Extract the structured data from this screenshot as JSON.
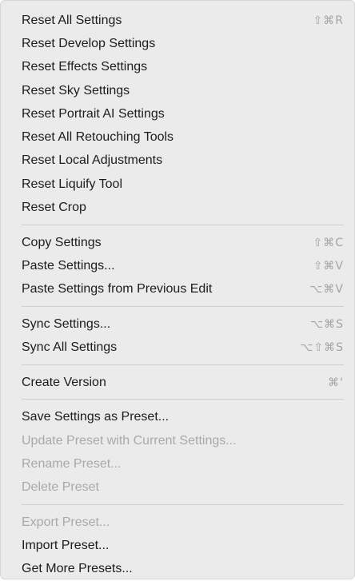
{
  "menu": {
    "groups": [
      [
        {
          "label": "Reset All Settings",
          "shortcut": "⇧⌘R",
          "enabled": true
        },
        {
          "label": "Reset Develop Settings",
          "shortcut": "",
          "enabled": true
        },
        {
          "label": "Reset Effects Settings",
          "shortcut": "",
          "enabled": true
        },
        {
          "label": "Reset Sky Settings",
          "shortcut": "",
          "enabled": true
        },
        {
          "label": "Reset Portrait AI Settings",
          "shortcut": "",
          "enabled": true
        },
        {
          "label": "Reset All Retouching Tools",
          "shortcut": "",
          "enabled": true
        },
        {
          "label": "Reset Local Adjustments",
          "shortcut": "",
          "enabled": true
        },
        {
          "label": "Reset Liquify Tool",
          "shortcut": "",
          "enabled": true
        },
        {
          "label": "Reset Crop",
          "shortcut": "",
          "enabled": true
        }
      ],
      [
        {
          "label": "Copy Settings",
          "shortcut": "⇧⌘C",
          "enabled": true
        },
        {
          "label": "Paste Settings...",
          "shortcut": "⇧⌘V",
          "enabled": true
        },
        {
          "label": "Paste Settings from Previous Edit",
          "shortcut": "⌥⌘V",
          "enabled": true
        }
      ],
      [
        {
          "label": "Sync Settings...",
          "shortcut": "⌥⌘S",
          "enabled": true
        },
        {
          "label": "Sync All Settings",
          "shortcut": "⌥⇧⌘S",
          "enabled": true
        }
      ],
      [
        {
          "label": "Create Version",
          "shortcut": "⌘'",
          "enabled": true
        }
      ],
      [
        {
          "label": "Save Settings as Preset...",
          "shortcut": "",
          "enabled": true
        },
        {
          "label": "Update Preset with Current Settings...",
          "shortcut": "",
          "enabled": false
        },
        {
          "label": "Rename Preset...",
          "shortcut": "",
          "enabled": false
        },
        {
          "label": "Delete Preset",
          "shortcut": "",
          "enabled": false
        }
      ],
      [
        {
          "label": "Export Preset...",
          "shortcut": "",
          "enabled": false
        },
        {
          "label": "Import Preset...",
          "shortcut": "",
          "enabled": true
        },
        {
          "label": "Get More Presets...",
          "shortcut": "",
          "enabled": true
        }
      ]
    ]
  }
}
